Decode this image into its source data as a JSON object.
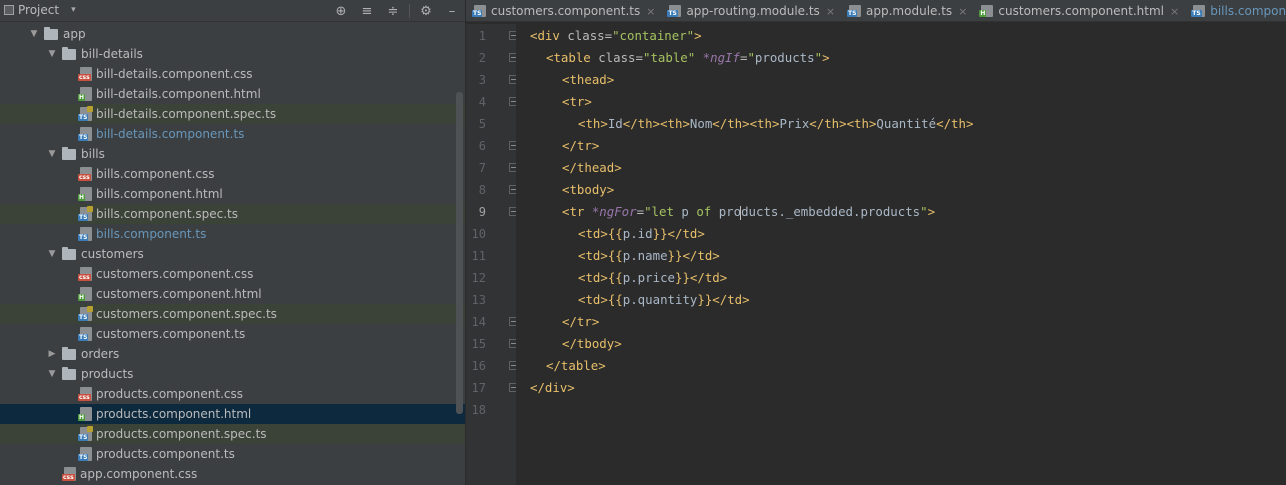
{
  "project_panel": {
    "title": "Project",
    "caret": "▾",
    "tools": [
      "locate-icon",
      "collapse-all-icon",
      "expand-all-icon",
      "gear-icon",
      "minimize-icon"
    ],
    "tree": [
      {
        "depth": 2,
        "type": "folder",
        "expanded": true,
        "label": "app"
      },
      {
        "depth": 3,
        "type": "folder",
        "expanded": true,
        "label": "bill-details"
      },
      {
        "depth": 4,
        "type": "css",
        "label": "bill-details.component.css"
      },
      {
        "depth": 4,
        "type": "html",
        "label": "bill-details.component.html"
      },
      {
        "depth": 4,
        "type": "spec",
        "label": "bill-details.component.spec.ts"
      },
      {
        "depth": 4,
        "type": "ts",
        "label": "bill-details.component.ts",
        "open": true
      },
      {
        "depth": 3,
        "type": "folder",
        "expanded": true,
        "label": "bills"
      },
      {
        "depth": 4,
        "type": "css",
        "label": "bills.component.css"
      },
      {
        "depth": 4,
        "type": "html",
        "label": "bills.component.html"
      },
      {
        "depth": 4,
        "type": "spec",
        "label": "bills.component.spec.ts"
      },
      {
        "depth": 4,
        "type": "ts",
        "label": "bills.component.ts",
        "open": true
      },
      {
        "depth": 3,
        "type": "folder",
        "expanded": true,
        "label": "customers"
      },
      {
        "depth": 4,
        "type": "css",
        "label": "customers.component.css"
      },
      {
        "depth": 4,
        "type": "html",
        "label": "customers.component.html"
      },
      {
        "depth": 4,
        "type": "spec",
        "label": "customers.component.spec.ts"
      },
      {
        "depth": 4,
        "type": "ts",
        "label": "customers.component.ts"
      },
      {
        "depth": 3,
        "type": "folder",
        "expanded": false,
        "label": "orders"
      },
      {
        "depth": 3,
        "type": "folder",
        "expanded": true,
        "label": "products"
      },
      {
        "depth": 4,
        "type": "css",
        "label": "products.component.css"
      },
      {
        "depth": 4,
        "type": "html",
        "label": "products.component.html",
        "selected": true
      },
      {
        "depth": 4,
        "type": "spec",
        "label": "products.component.spec.ts"
      },
      {
        "depth": 4,
        "type": "ts",
        "label": "products.component.ts"
      },
      {
        "depth": 3,
        "type": "css",
        "label": "app.component.css"
      }
    ]
  },
  "tabs": [
    {
      "type": "ts",
      "label": "customers.component.ts",
      "close": "×",
      "active": false
    },
    {
      "type": "ts",
      "label": "app-routing.module.ts",
      "close": "×",
      "active": false
    },
    {
      "type": "ts",
      "label": "app.module.ts",
      "close": "×",
      "active": false
    },
    {
      "type": "html",
      "label": "customers.component.html",
      "close": "×",
      "active": false
    },
    {
      "type": "ts",
      "label": "bills.component.ts",
      "close": "×",
      "active": true
    }
  ],
  "editor": {
    "current_line": 9,
    "lines": [
      {
        "n": "1",
        "indent": 0,
        "fold": true,
        "html": "<span class='t'>&lt;div </span><span class='a'>class=</span><span class='s'>\"container\"</span><span class='t'>&gt;</span>"
      },
      {
        "n": "2",
        "indent": 1,
        "fold": true,
        "html": "<span class='t'>&lt;table </span><span class='a'>class=</span><span class='s'>\"table\" </span><span class='d'>*ngIf</span><span class='a'>=</span><span class='s'>\"</span><span class='p'>products</span><span class='s'>\"</span><span class='t'>&gt;</span>"
      },
      {
        "n": "3",
        "indent": 2,
        "fold": true,
        "html": "<span class='t'>&lt;thead&gt;</span>"
      },
      {
        "n": "4",
        "indent": 2,
        "fold": true,
        "html": "<span class='t'>&lt;tr&gt;</span>"
      },
      {
        "n": "5",
        "indent": 3,
        "fold": false,
        "html": "<span class='t'>&lt;th&gt;</span><span class='x'>Id</span><span class='t'>&lt;/th&gt;&lt;th&gt;</span><span class='x'>Nom</span><span class='t'>&lt;/th&gt;&lt;th&gt;</span><span class='x'>Prix</span><span class='t'>&lt;/th&gt;&lt;th&gt;</span><span class='x'>Quantité</span><span class='t'>&lt;/th&gt;</span>"
      },
      {
        "n": "6",
        "indent": 2,
        "fold": true,
        "html": "<span class='t'>&lt;/tr&gt;</span>"
      },
      {
        "n": "7",
        "indent": 2,
        "fold": true,
        "html": "<span class='t'>&lt;/thead&gt;</span>"
      },
      {
        "n": "8",
        "indent": 2,
        "fold": true,
        "html": "<span class='t'>&lt;tbody&gt;</span>"
      },
      {
        "n": "9",
        "indent": 2,
        "fold": true,
        "html": "<span class='t'>&lt;tr </span><span class='d'>*ngFor</span><span class='a'>=</span><span class='s'>\"</span><span class='s'>let </span><span class='p'>p </span><span class='s'>of </span><span class='p'>pro<span class='caret'></span>ducts.</span><span class='p'>_embedded.products</span><span class='s'>\"</span><span class='t'>&gt;</span>"
      },
      {
        "n": "10",
        "indent": 3,
        "fold": false,
        "html": "<span class='t'>&lt;td&gt;</span><span class='br'>{{</span><span class='p'>p.id</span><span class='br'>}}</span><span class='t'>&lt;/td&gt;</span>"
      },
      {
        "n": "11",
        "indent": 3,
        "fold": false,
        "html": "<span class='t'>&lt;td&gt;</span><span class='br'>{{</span><span class='p'>p.name</span><span class='br'>}}</span><span class='t'>&lt;/td&gt;</span>"
      },
      {
        "n": "12",
        "indent": 3,
        "fold": false,
        "html": "<span class='t'>&lt;td&gt;</span><span class='br'>{{</span><span class='p'>p.price</span><span class='br'>}}</span><span class='t'>&lt;/td&gt;</span>"
      },
      {
        "n": "13",
        "indent": 3,
        "fold": false,
        "html": "<span class='t'>&lt;td&gt;</span><span class='br'>{{</span><span class='p'>p.quantity</span><span class='br'>}}</span><span class='t'>&lt;/td&gt;</span>"
      },
      {
        "n": "14",
        "indent": 2,
        "fold": true,
        "html": "<span class='t'>&lt;/tr&gt;</span>"
      },
      {
        "n": "15",
        "indent": 2,
        "fold": true,
        "html": "<span class='t'>&lt;/tbody&gt;</span>"
      },
      {
        "n": "16",
        "indent": 1,
        "fold": true,
        "html": "<span class='t'>&lt;/table&gt;</span>"
      },
      {
        "n": "17",
        "indent": 0,
        "fold": true,
        "html": "<span class='t'>&lt;/div&gt;</span>"
      },
      {
        "n": "18",
        "indent": 0,
        "fold": false,
        "html": ""
      }
    ]
  }
}
